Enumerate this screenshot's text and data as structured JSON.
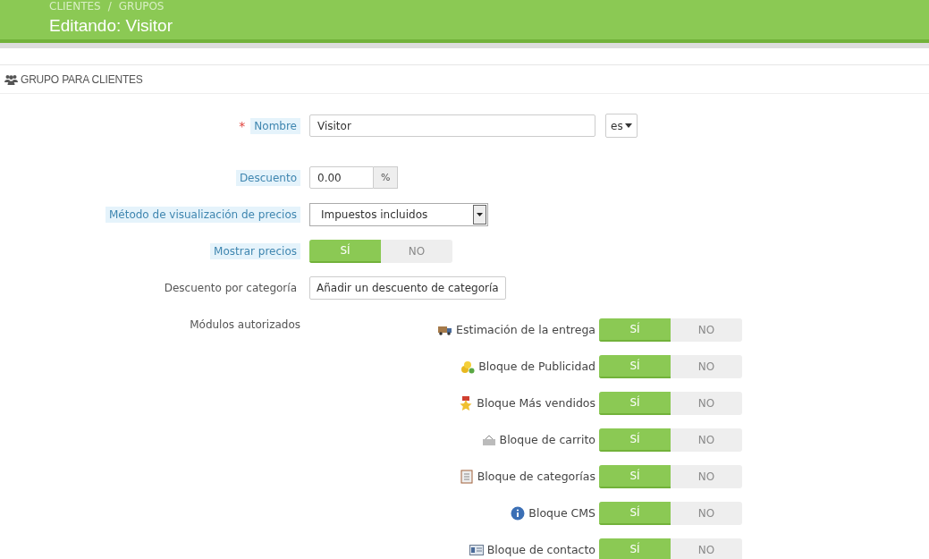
{
  "header": {
    "breadcrumb": [
      "CLIENTES",
      "GRUPOS"
    ],
    "breadcrumb_separator": "/",
    "title": "Editando: Visitor"
  },
  "panel": {
    "heading": "GRUPO PARA CLIENTES",
    "fields": [
      {
        "kind": "text",
        "label": "Nombre",
        "required_mark": "*",
        "help": true,
        "value": "Visitor",
        "language": "es"
      },
      {
        "kind": "addon",
        "label": "Descuento",
        "help": true,
        "value": "0.00",
        "addon": "%"
      },
      {
        "kind": "select",
        "label": "Método de visualización de precios",
        "help": true,
        "value": "Impuestos incluidos"
      },
      {
        "kind": "switch",
        "label": "Mostrar precios",
        "help": true,
        "yes": "SÍ",
        "no": "NO",
        "on": true
      },
      {
        "kind": "button",
        "label": "Descuento por categoría",
        "help": false,
        "button": "Añadir un descuento de categoría"
      }
    ],
    "modules_label": "Módulos autorizados",
    "modules": [
      {
        "kind": "truck",
        "name": "Estimación de la entrega",
        "yes": "SÍ",
        "no": "NO",
        "on": true
      },
      {
        "kind": "coins",
        "name": "Bloque de Publicidad",
        "yes": "SÍ",
        "no": "NO",
        "on": true
      },
      {
        "kind": "medal",
        "name": "Bloque Más vendidos",
        "yes": "SÍ",
        "no": "NO",
        "on": true
      },
      {
        "kind": "basket",
        "name": "Bloque de carrito",
        "yes": "SÍ",
        "no": "NO",
        "on": true
      },
      {
        "kind": "notebook",
        "name": "Bloque de categorías",
        "yes": "SÍ",
        "no": "NO",
        "on": true
      },
      {
        "kind": "info",
        "name": "Bloque CMS",
        "yes": "SÍ",
        "no": "NO",
        "on": true
      },
      {
        "kind": "card",
        "name": "Bloque de contacto",
        "yes": "SÍ",
        "no": "NO",
        "on": true
      }
    ]
  }
}
